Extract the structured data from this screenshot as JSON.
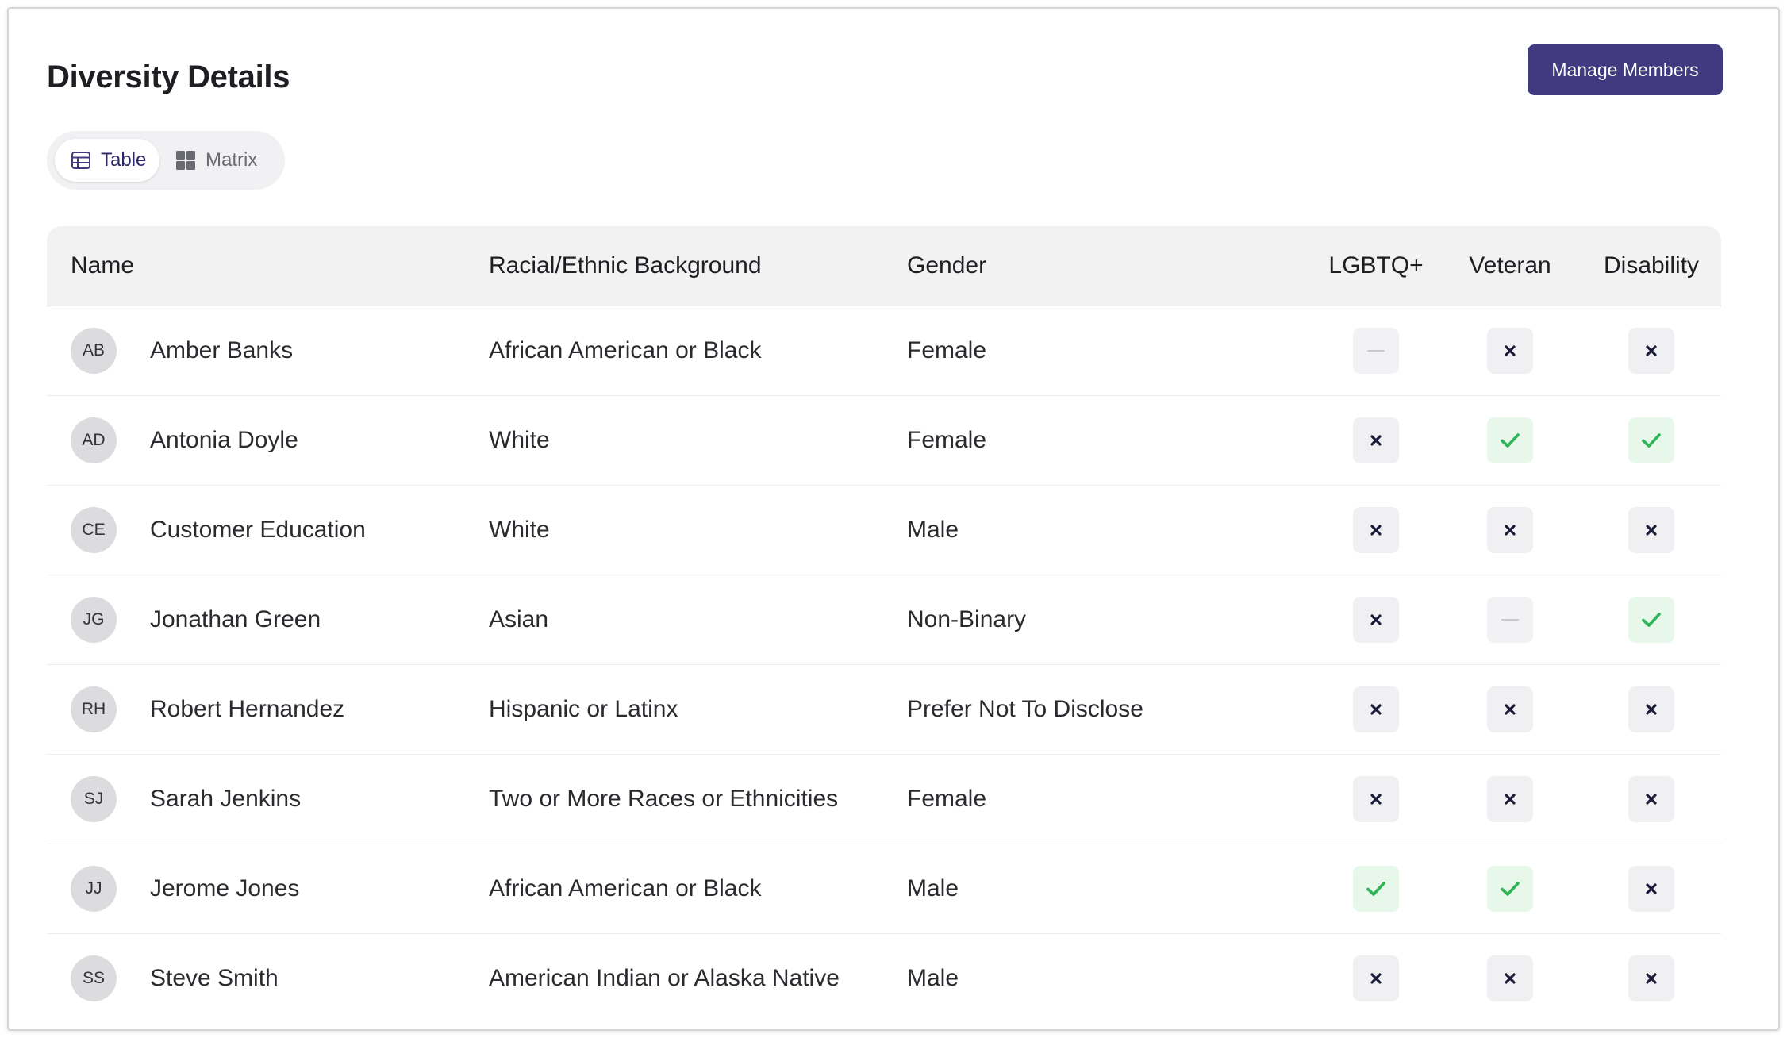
{
  "page": {
    "title": "Diversity Details",
    "manage_button": "Manage Members"
  },
  "view_toggle": {
    "table_label": "Table",
    "matrix_label": "Matrix",
    "selected": "Table"
  },
  "table": {
    "headers": {
      "name": "Name",
      "race": "Racial/Ethnic Background",
      "gender": "Gender",
      "lgbt": "LGBTQ+",
      "veteran": "Veteran",
      "disability": "Disability"
    },
    "rows": [
      {
        "initials": "AB",
        "name": "Amber Banks",
        "race": "African American or Black",
        "gender": "Female",
        "lgbt": "na",
        "veteran": "no",
        "disability": "no"
      },
      {
        "initials": "AD",
        "name": "Antonia Doyle",
        "race": "White",
        "gender": "Female",
        "lgbt": "no",
        "veteran": "yes",
        "disability": "yes"
      },
      {
        "initials": "CE",
        "name": "Customer Education",
        "race": "White",
        "gender": "Male",
        "lgbt": "no",
        "veteran": "no",
        "disability": "no"
      },
      {
        "initials": "JG",
        "name": "Jonathan Green",
        "race": "Asian",
        "gender": "Non-Binary",
        "lgbt": "no",
        "veteran": "na",
        "disability": "yes"
      },
      {
        "initials": "RH",
        "name": "Robert Hernandez",
        "race": "Hispanic or Latinx",
        "gender": "Prefer Not To Disclose",
        "lgbt": "no",
        "veteran": "no",
        "disability": "no"
      },
      {
        "initials": "SJ",
        "name": "Sarah Jenkins",
        "race": "Two or More Races or Ethnicities",
        "gender": "Female",
        "lgbt": "no",
        "veteran": "no",
        "disability": "no"
      },
      {
        "initials": "JJ",
        "name": "Jerome Jones",
        "race": "African American or Black",
        "gender": "Male",
        "lgbt": "yes",
        "veteran": "yes",
        "disability": "no"
      },
      {
        "initials": "SS",
        "name": "Steve Smith",
        "race": "American Indian or Alaska Native",
        "gender": "Male",
        "lgbt": "no",
        "veteran": "no",
        "disability": "no"
      }
    ]
  },
  "icons": {
    "yes": "check-icon",
    "no": "x-icon",
    "na": "dash-icon",
    "table": "table-icon",
    "matrix": "grid-icon"
  },
  "colors": {
    "accent": "#423a80",
    "check": "#2fb457",
    "x_mark": "#1b1b3a",
    "dash": "#c8c8cc"
  }
}
